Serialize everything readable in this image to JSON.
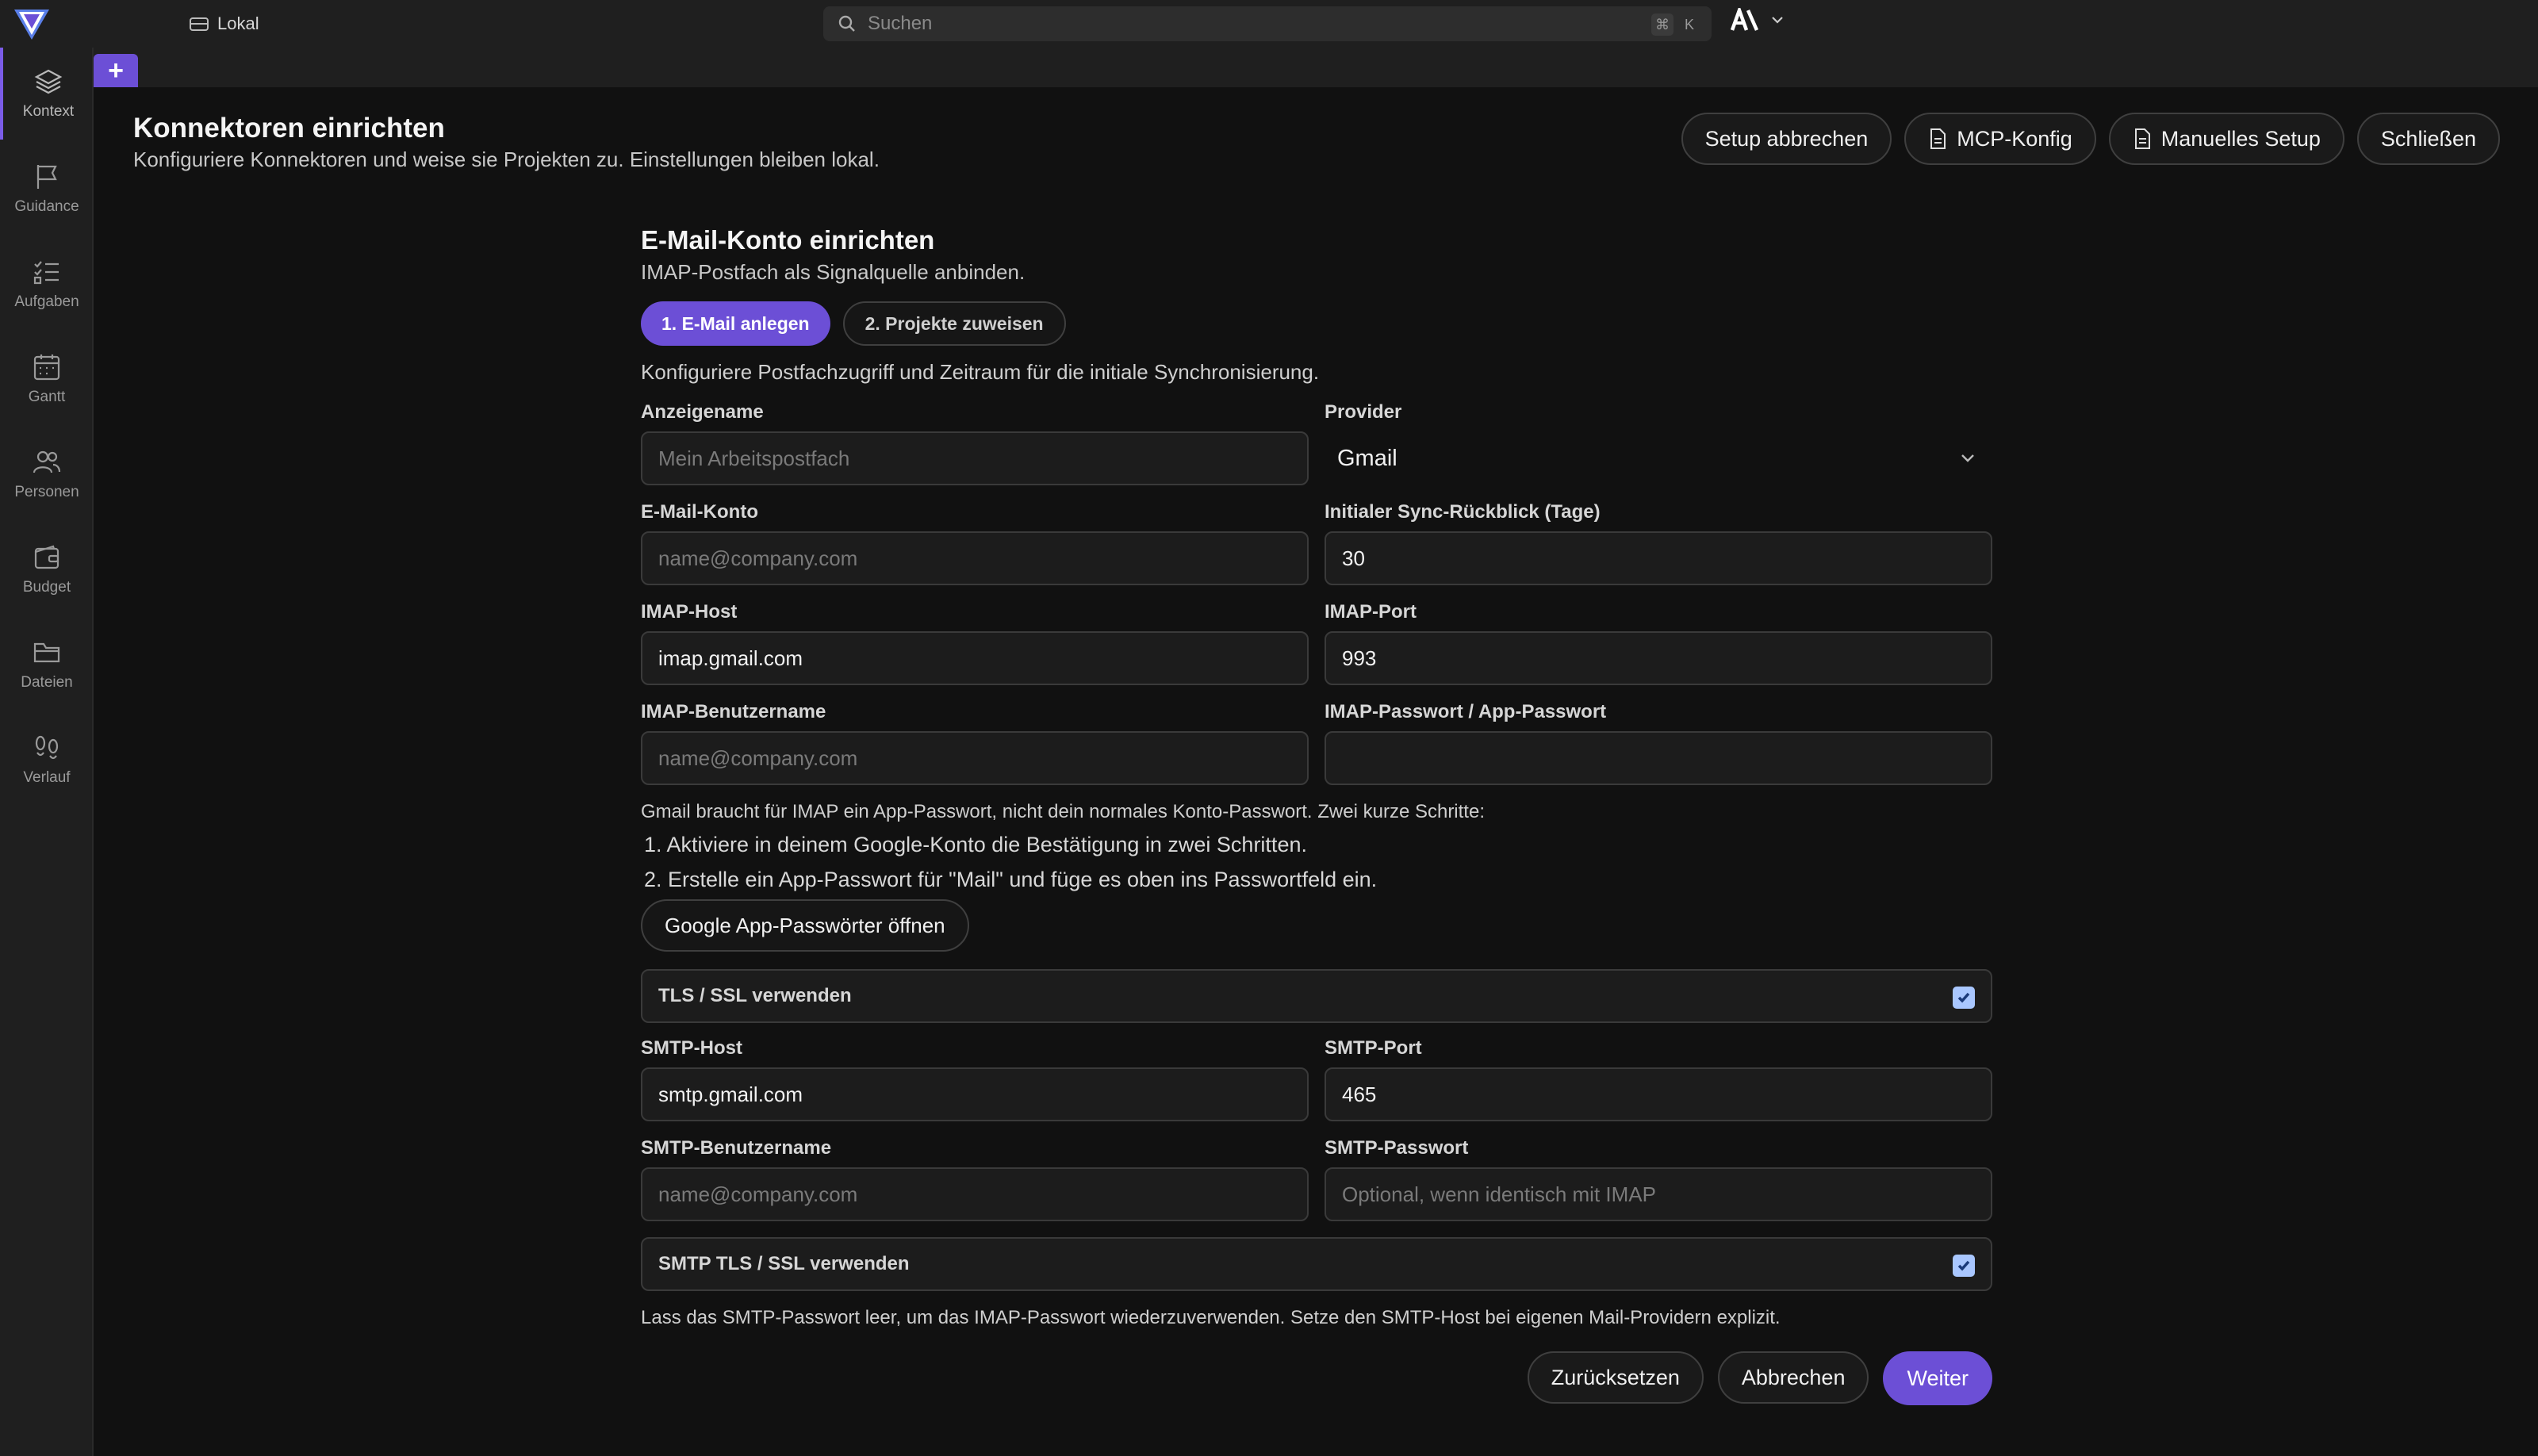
{
  "topbar": {
    "workspace": "Lokal",
    "search_placeholder": "Suchen",
    "shortcut_cmd": "⌘",
    "shortcut_key": "K",
    "account": "A\\"
  },
  "tabs": {
    "add_label": "+"
  },
  "sidebar": {
    "items": [
      {
        "label": "Kontext",
        "icon": "layers-icon"
      },
      {
        "label": "Guidance",
        "icon": "flag-icon"
      },
      {
        "label": "Aufgaben",
        "icon": "tasks-icon"
      },
      {
        "label": "Gantt",
        "icon": "calendar-icon"
      },
      {
        "label": "Personen",
        "icon": "people-icon"
      },
      {
        "label": "Budget",
        "icon": "wallet-icon"
      },
      {
        "label": "Dateien",
        "icon": "folder-icon"
      },
      {
        "label": "Verlauf",
        "icon": "footsteps-icon"
      }
    ]
  },
  "header": {
    "title": "Konnektoren einrichten",
    "subtitle": "Konfiguriere Konnektoren und weise sie Projekten zu. Einstellungen bleiben lokal.",
    "btn_cancel_setup": "Setup abbrechen",
    "btn_mcp": "MCP-Konfig",
    "btn_manual": "Manuelles Setup",
    "btn_close": "Schließen"
  },
  "form": {
    "title": "E-Mail-Konto einrichten",
    "subtitle": "IMAP-Postfach als Signalquelle anbinden.",
    "step1": "1. E-Mail anlegen",
    "step2": "2. Projekte zuweisen",
    "intro": "Konfiguriere Postfachzugriff und Zeitraum für die initiale Synchronisierung.",
    "display_name": {
      "label": "Anzeigename",
      "value": "",
      "placeholder": "Mein Arbeitspostfach"
    },
    "provider": {
      "label": "Provider",
      "value": "Gmail"
    },
    "email": {
      "label": "E-Mail-Konto",
      "value": "",
      "placeholder": "name@company.com"
    },
    "sync_days": {
      "label": "Initialer Sync-Rückblick (Tage)",
      "value": "30"
    },
    "imap_host": {
      "label": "IMAP-Host",
      "value": "imap.gmail.com"
    },
    "imap_port": {
      "label": "IMAP-Port",
      "value": "993"
    },
    "imap_user": {
      "label": "IMAP-Benutzername",
      "value": "",
      "placeholder": "name@company.com"
    },
    "imap_pass": {
      "label": "IMAP-Passwort / App-Passwort",
      "value": ""
    },
    "gmail_hint": "Gmail braucht für IMAP ein App-Passwort, nicht dein normales Konto-Passwort. Zwei kurze Schritte:",
    "gmail_step1": "1. Aktiviere in deinem Google-Konto die Bestätigung in zwei Schritten.",
    "gmail_step2": "2. Erstelle ein App-Passwort für \"Mail\" und füge es oben ins Passwortfeld ein.",
    "google_btn": "Google App-Passwörter öffnen",
    "tls": {
      "label": "TLS / SSL verwenden",
      "checked": true
    },
    "smtp_host": {
      "label": "SMTP-Host",
      "value": "smtp.gmail.com"
    },
    "smtp_port": {
      "label": "SMTP-Port",
      "value": "465"
    },
    "smtp_user": {
      "label": "SMTP-Benutzername",
      "value": "",
      "placeholder": "name@company.com"
    },
    "smtp_pass": {
      "label": "SMTP-Passwort",
      "value": "",
      "placeholder": "Optional, wenn identisch mit IMAP"
    },
    "smtp_tls": {
      "label": "SMTP TLS / SSL verwenden",
      "checked": true
    },
    "smtp_hint": "Lass das SMTP-Passwort leer, um das IMAP-Passwort wiederzuverwenden. Setze den SMTP-Host bei eigenen Mail-Providern explizit.",
    "btn_reset": "Zurücksetzen",
    "btn_cancel": "Abbrechen",
    "btn_next": "Weiter"
  }
}
